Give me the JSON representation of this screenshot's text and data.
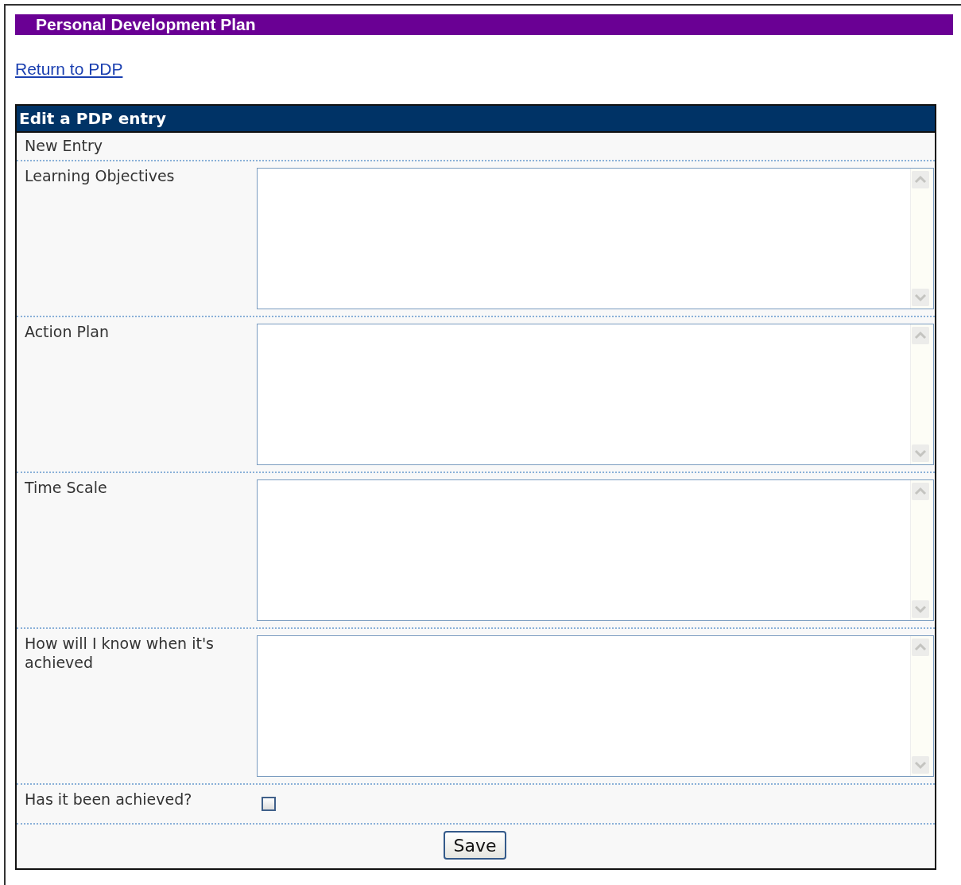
{
  "page_title": "Personal Development Plan",
  "return_link": "Return to PDP",
  "form": {
    "title": "Edit a PDP entry",
    "subtitle": "New Entry",
    "fields": [
      {
        "kind": "textarea",
        "label": "Learning Objectives"
      },
      {
        "kind": "textarea",
        "label": "Action Plan"
      },
      {
        "kind": "textarea",
        "label": "Time Scale"
      },
      {
        "kind": "textarea",
        "label": "How will I know when it's achieved"
      },
      {
        "kind": "checkbox",
        "label": "Has it been achieved?",
        "checked": false
      }
    ],
    "save_button": "Save"
  }
}
